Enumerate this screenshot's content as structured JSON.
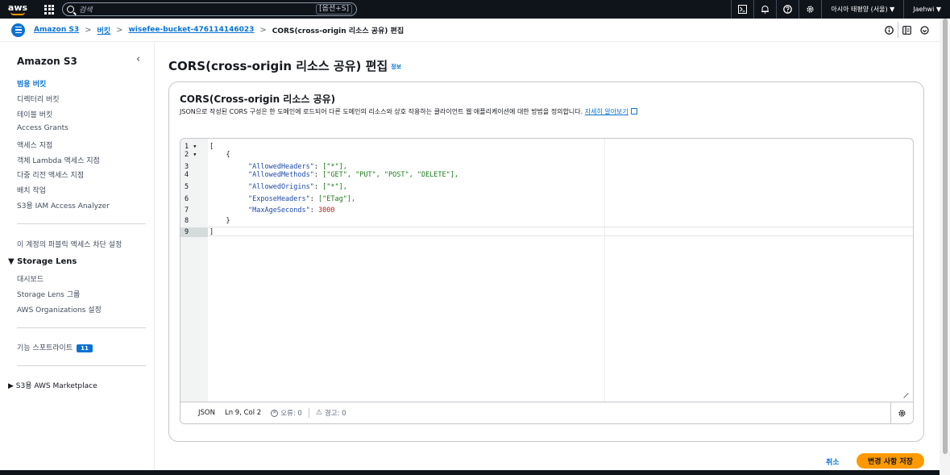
{
  "topnav": {
    "logo_text": "aws",
    "search_placeholder": "검색",
    "search_shortcut": "[옵션+S]",
    "region": "아시아 태평양 (서울) ▼",
    "user": "Jaehwi ▼",
    "icons": [
      "cloudshell-icon",
      "bell-icon",
      "help-icon",
      "gear-icon"
    ]
  },
  "breadcrumb": {
    "items": [
      "Amazon S3",
      "버킷",
      "wisefee-bucket-476114146023"
    ],
    "current": "CORS(cross-origin 리소스 공유) 편집",
    "separator": ">"
  },
  "sidebar": {
    "title": "Amazon S3",
    "close": "‹",
    "items": [
      "범용 버킷",
      "디렉터리 버킷",
      "테이블 버킷",
      "Access Grants",
      "액세스 지점",
      "객체 Lambda 액세스 지점",
      "다중 리전 액세스 지점",
      "배치 작업",
      "S3용 IAM Access Analyzer"
    ],
    "block_public": "이 계정의 퍼블릭 액세스 차단 설정",
    "storage_lens": {
      "label": "▼ Storage Lens",
      "items": [
        "대시보드",
        "Storage Lens 그룹",
        "AWS Organizations 설정"
      ]
    },
    "feature_spotlight": "기능 스포트라이트",
    "feature_badge": "11",
    "marketplace": "▶ S3용 AWS Marketplace"
  },
  "main": {
    "title": "CORS(cross-origin 리소스 공유) 편집",
    "info": "정보",
    "panel": {
      "heading": "CORS(Cross-origin 리소스 공유)",
      "description": "JSON으로 작성된 CORS 구성은 한 도메인에 로드되어 다른 도메인의 리소스와 상호 작용하는 클라이언트 웹 애플리케이션에 대한 방법을 정의합니다.",
      "learn_more": "자세히 알아보기"
    },
    "editor": {
      "line_numbers": [
        "1 ▾",
        "2 ▾",
        "3",
        "4",
        "5",
        "6",
        "7",
        "8",
        "9"
      ],
      "code": {
        "l1": "[",
        "l2": "    {",
        "l3k": "\"AllowedHeaders\"",
        "l3v": "[\"*\"],",
        "l4k": "\"AllowedMethods\"",
        "l4v": "[\"GET\", \"PUT\", \"POST\", \"DELETE\"],",
        "l5k": "\"AllowedOrigins\"",
        "l5v": "[\"*\"],",
        "l6k": "\"ExposeHeaders\"",
        "l6v": "[\"ETag\"],",
        "l7k": "\"MaxAgeSeconds\"",
        "l7v": "3000",
        "l8": "    }",
        "l9": "]"
      },
      "status": {
        "language": "JSON",
        "position": "Ln 9, Col 2",
        "errors": "오류: 0",
        "warnings": "경고: 0"
      }
    },
    "cancel": "취소",
    "save": "변경 사항 저장"
  },
  "colors": {
    "accent": "#0972d3",
    "primary_button": "#ff9900",
    "nav_bg": "#0f141a"
  }
}
